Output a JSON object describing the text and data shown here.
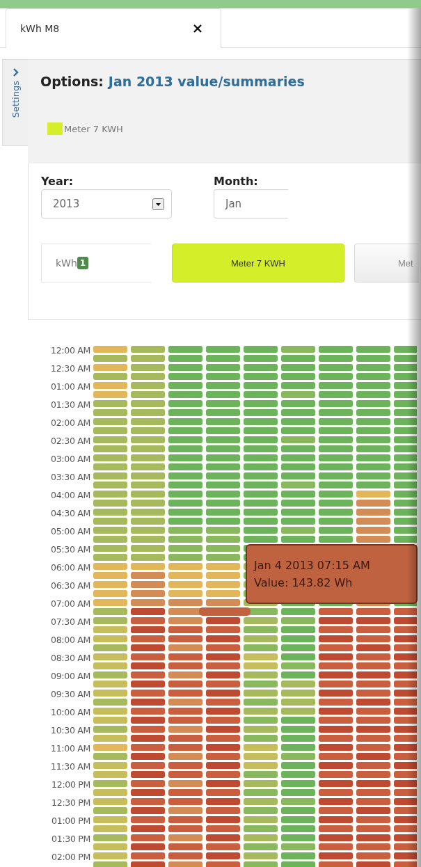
{
  "tabs": [
    {
      "label": "kWh M8",
      "selected": true
    }
  ],
  "side_tab": {
    "label": "Settings"
  },
  "options": {
    "label": "Options:",
    "value": "Jan 2013 value/summaries",
    "legend": [
      {
        "label": "Meter 7 KWH",
        "color": "#d4ef2a"
      }
    ]
  },
  "filters": {
    "year": {
      "label": "Year:",
      "value": "2013"
    },
    "month": {
      "label": "Month:",
      "value": "Jan"
    }
  },
  "units": {
    "value": "kWh",
    "badge": "1"
  },
  "meters": [
    {
      "label": "Meter 7 KWH",
      "selected": true
    },
    {
      "label": "Met",
      "selected": false
    }
  ],
  "heatmap": {
    "row_labels": [
      "12:00 AM",
      "12:30 AM",
      "01:00 AM",
      "01:30 AM",
      "02:00 AM",
      "02:30 AM",
      "03:00 AM",
      "03:30 AM",
      "04:00 AM",
      "04:30 AM",
      "05:00 AM",
      "05:30 AM",
      "06:00 AM",
      "06:30 AM",
      "07:00 AM",
      "07:30 AM",
      "08:00 AM",
      "08:30 AM",
      "09:00 AM",
      "09:30 AM",
      "10:00 AM",
      "10:30 AM",
      "11:00 AM",
      "11:30 AM",
      "12:00 PM",
      "12:30 PM",
      "01:00 PM",
      "01:30 PM",
      "02:00 PM"
    ],
    "tooltip": [
      "Jan 4 2013 07:15 AM",
      "Value: 143.82 Wh"
    ]
  }
}
